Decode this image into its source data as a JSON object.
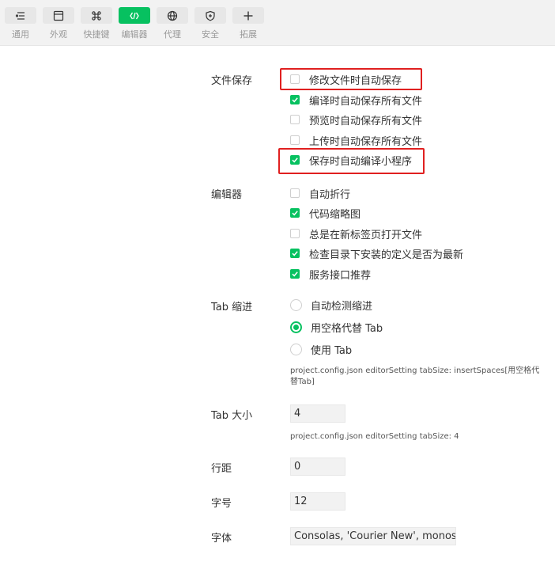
{
  "toolbar": {
    "items": [
      {
        "label": "通用",
        "icon": "list-settings-icon",
        "active": false
      },
      {
        "label": "外观",
        "icon": "window-icon",
        "active": false
      },
      {
        "label": "快捷键",
        "icon": "command-key-icon",
        "active": false
      },
      {
        "label": "编辑器",
        "icon": "code-brackets-icon",
        "active": true
      },
      {
        "label": "代理",
        "icon": "globe-icon",
        "active": false
      },
      {
        "label": "安全",
        "icon": "shield-icon",
        "active": false
      },
      {
        "label": "拓展",
        "icon": "plus-icon",
        "active": false
      }
    ],
    "active_color": "#07c160"
  },
  "file_save": {
    "label": "文件保存",
    "options": [
      {
        "label": "修改文件时自动保存",
        "checked": false
      },
      {
        "label": "编译时自动保存所有文件",
        "checked": true
      },
      {
        "label": "预览时自动保存所有文件",
        "checked": false
      },
      {
        "label": "上传时自动保存所有文件",
        "checked": false
      },
      {
        "label": "保存时自动编译小程序",
        "checked": true
      }
    ]
  },
  "editor": {
    "label": "编辑器",
    "options": [
      {
        "label": "自动折行",
        "checked": false
      },
      {
        "label": "代码缩略图",
        "checked": true
      },
      {
        "label": "总是在新标签页打开文件",
        "checked": false
      },
      {
        "label": "检查目录下安装的定义是否为最新",
        "checked": true
      },
      {
        "label": "服务接口推荐",
        "checked": true
      }
    ]
  },
  "tab_indent": {
    "label": "Tab 缩进",
    "options": [
      {
        "label": "自动检测缩进",
        "checked": false
      },
      {
        "label": "用空格代替 Tab",
        "checked": true
      },
      {
        "label": "使用 Tab",
        "checked": false
      }
    ],
    "hint": "project.config.json editorSetting tabSize: insertSpaces[用空格代替Tab]"
  },
  "tab_size": {
    "label": "Tab 大小",
    "value": "4",
    "hint": "project.config.json editorSetting tabSize: 4"
  },
  "line_height": {
    "label": "行距",
    "value": "0"
  },
  "font_size": {
    "label": "字号",
    "value": "12"
  },
  "font_family": {
    "label": "字体",
    "value": "Consolas, 'Courier New', monospace"
  },
  "colors": {
    "highlight": "#e02020",
    "checkbox": "#07c160"
  }
}
